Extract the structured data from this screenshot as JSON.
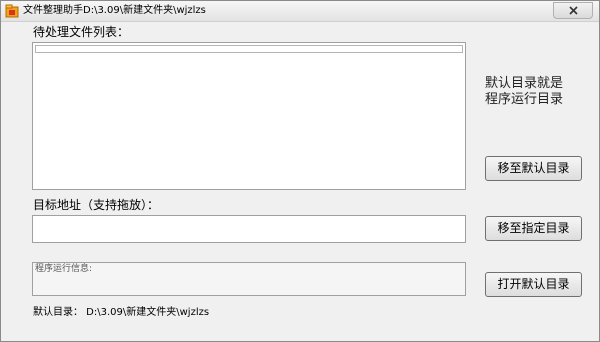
{
  "window": {
    "title": "文件整理助手D:\\3.09\\新建文件夹\\wjzlzs"
  },
  "labels": {
    "pending_files": "待处理文件列表：",
    "target_address": "目标地址（支持拖放）：",
    "note_line1": "默认目录就是",
    "note_line2": "程序运行目录",
    "info_placeholder": "程序运行信息:",
    "default_dir": "默认目录： D:\\3.09\\新建文件夹\\wjzlzs"
  },
  "inputs": {
    "target_value": ""
  },
  "buttons": {
    "move_to_default": "移至默认目录",
    "move_to_specified": "移至指定目录",
    "open_default": "打开默认目录"
  },
  "colors": {
    "background": "#f0f0f0",
    "icon_orange": "#f2a31b",
    "icon_red": "#d9321f"
  },
  "icons": {
    "app": "folder-tool-icon",
    "close": "close-icon"
  }
}
